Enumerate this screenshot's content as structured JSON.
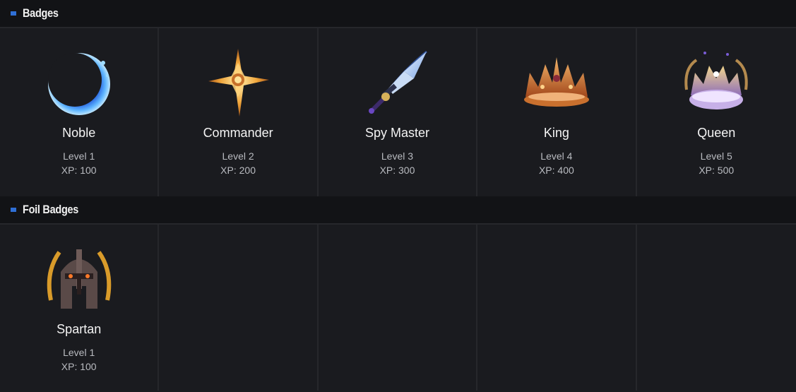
{
  "sections": [
    {
      "title": "Badges",
      "badges": [
        {
          "name": "Noble",
          "level": "Level 1",
          "xp": "XP: 100",
          "icon": "crescent-moon-icon"
        },
        {
          "name": "Commander",
          "level": "Level 2",
          "xp": "XP: 200",
          "icon": "compass-star-icon"
        },
        {
          "name": "Spy Master",
          "level": "Level 3",
          "xp": "XP: 300",
          "icon": "dagger-icon"
        },
        {
          "name": "King",
          "level": "Level 4",
          "xp": "XP: 400",
          "icon": "king-crown-icon"
        },
        {
          "name": "Queen",
          "level": "Level 5",
          "xp": "XP: 500",
          "icon": "queen-crown-icon"
        }
      ]
    },
    {
      "title": "Foil Badges",
      "badges": [
        {
          "name": "Spartan",
          "level": "Level 1",
          "xp": "XP: 100",
          "icon": "spartan-helmet-icon"
        }
      ]
    }
  ],
  "colors": {
    "background": "#1a1b1f",
    "header_background": "#121316",
    "accent": "#2f6fd6",
    "divider": "#26272b"
  }
}
